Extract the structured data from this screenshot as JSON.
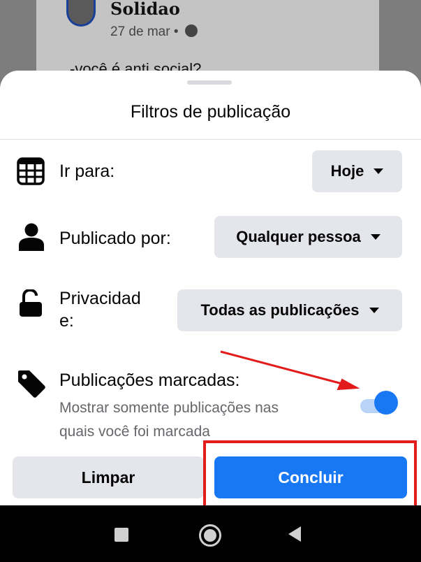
{
  "background_post": {
    "author": "Solidao",
    "date": "27 de mar",
    "separator": "•",
    "text": "-você é anti social?"
  },
  "sheet": {
    "title": "Filtros de publicação",
    "rows": [
      {
        "label": "Ir para:",
        "value": "Hoje",
        "icon": "calendar-icon"
      },
      {
        "label": "Publicado por:",
        "value": "Qualquer pessoa",
        "icon": "person-icon"
      },
      {
        "label_line1": "Privacidad",
        "label_line2": "e:",
        "value": "Todas as publicações",
        "icon": "unlock-icon"
      }
    ],
    "tagged": {
      "label": "Publicações marcadas:",
      "description_line1": "Mostrar somente publicações nas",
      "description_line2": "quais você foi marcada",
      "icon": "tag-icon",
      "toggle_on": true
    },
    "buttons": {
      "clear": "Limpar",
      "done": "Concluir"
    }
  },
  "annotations": {
    "arrow_color": "#e21b1b",
    "box_color": "#e21b1b"
  },
  "colors": {
    "accent": "#1877f2",
    "pill_bg": "#e4e6eb"
  },
  "navbar": {
    "buttons": [
      "recents-square-icon",
      "home-circle-icon",
      "back-triangle-icon"
    ]
  }
}
